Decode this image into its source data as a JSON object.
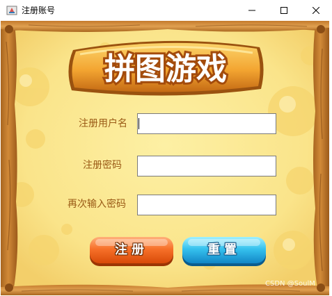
{
  "window": {
    "title": "注册账号",
    "controls": {
      "minimize": "minimize-icon",
      "maximize": "maximize-icon",
      "close": "close-icon"
    }
  },
  "logo": {
    "text": "拼图游戏"
  },
  "form": {
    "username_label": "注册用户名",
    "password_label": "注册密码",
    "confirm_label": "再次输入密码",
    "username_value": "",
    "password_value": "",
    "confirm_value": ""
  },
  "buttons": {
    "register_label": "注册",
    "reset_label": "重置"
  },
  "watermark": "CSDN @SoulM",
  "colors": {
    "background": "#f3c86e",
    "label": "#9a5a16",
    "register_button": "#f26a1b",
    "reset_button": "#29b6e8"
  }
}
